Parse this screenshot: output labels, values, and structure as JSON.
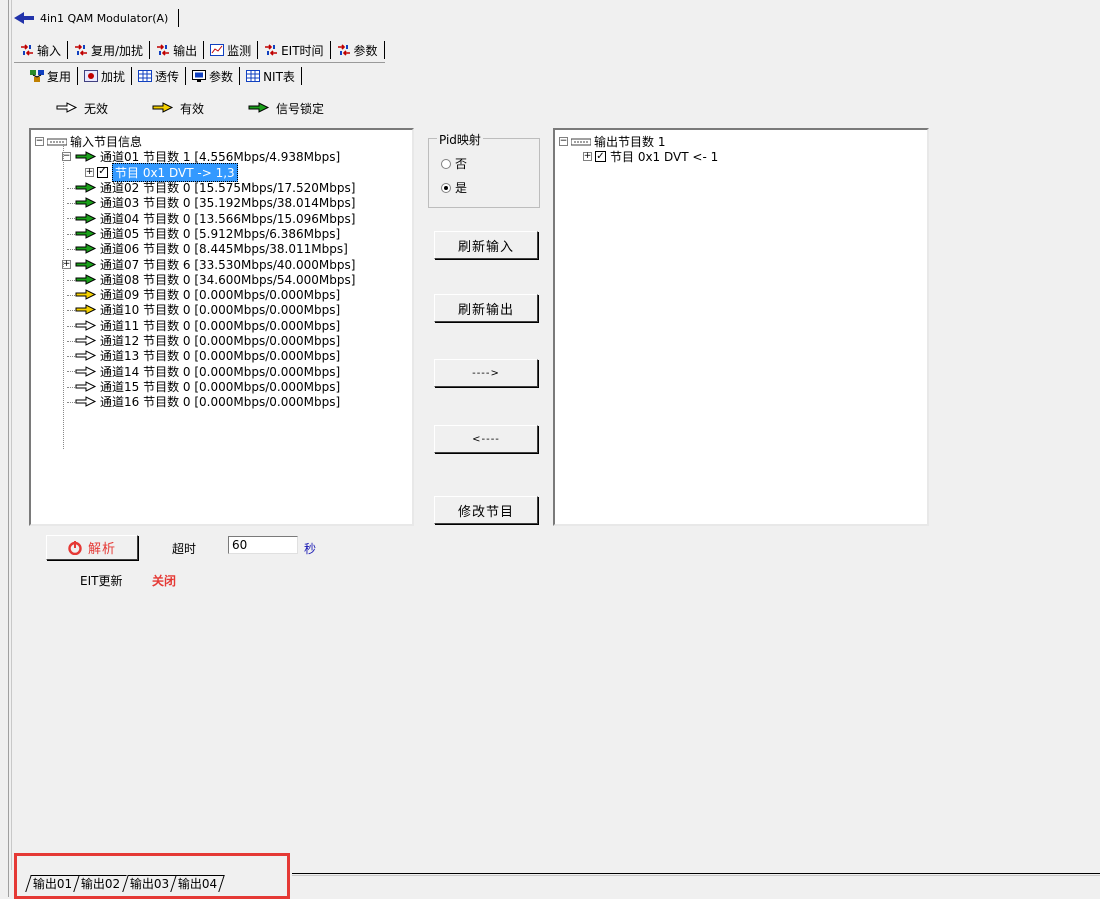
{
  "window": {
    "title": "4in1 QAM Modulator(A)"
  },
  "main_tabs": [
    "输入",
    "复用/加扰",
    "输出",
    "监测",
    "EIT时间",
    "参数"
  ],
  "sub_tabs": [
    "复用",
    "加扰",
    "透传",
    "参数",
    "NIT表"
  ],
  "legend": [
    {
      "label": "无效",
      "color": "#ffffff"
    },
    {
      "label": "有效",
      "color": "#f5d000"
    },
    {
      "label": "信号锁定",
      "color": "#1aa01a"
    }
  ],
  "input_tree": {
    "root": "输入节目信息",
    "channels": [
      {
        "text": "通道01 节目数 1 [4.556Mbps/4.938Mbps]",
        "status": "locked",
        "expanded": true,
        "children": [
          {
            "text": "节目 0x1 DVT -> 1,3",
            "checked": true,
            "selected": true
          }
        ]
      },
      {
        "text": "通道02 节目数 0 [15.575Mbps/17.520Mbps]",
        "status": "locked"
      },
      {
        "text": "通道03 节目数 0 [35.192Mbps/38.014Mbps]",
        "status": "locked"
      },
      {
        "text": "通道04 节目数 0 [13.566Mbps/15.096Mbps]",
        "status": "locked"
      },
      {
        "text": "通道05 节目数 0 [5.912Mbps/6.386Mbps]",
        "status": "locked"
      },
      {
        "text": "通道06 节目数 0 [8.445Mbps/38.011Mbps]",
        "status": "locked"
      },
      {
        "text": "通道07 节目数 6 [33.530Mbps/40.000Mbps]",
        "status": "locked",
        "collapsed": true
      },
      {
        "text": "通道08 节目数 0 [34.600Mbps/54.000Mbps]",
        "status": "locked"
      },
      {
        "text": "通道09 节目数 0 [0.000Mbps/0.000Mbps]",
        "status": "valid"
      },
      {
        "text": "通道10 节目数 0 [0.000Mbps/0.000Mbps]",
        "status": "valid"
      },
      {
        "text": "通道11 节目数 0 [0.000Mbps/0.000Mbps]",
        "status": "invalid"
      },
      {
        "text": "通道12 节目数 0 [0.000Mbps/0.000Mbps]",
        "status": "invalid"
      },
      {
        "text": "通道13 节目数 0 [0.000Mbps/0.000Mbps]",
        "status": "invalid"
      },
      {
        "text": "通道14 节目数 0 [0.000Mbps/0.000Mbps]",
        "status": "invalid"
      },
      {
        "text": "通道15 节目数 0 [0.000Mbps/0.000Mbps]",
        "status": "invalid"
      },
      {
        "text": "通道16 节目数 0 [0.000Mbps/0.000Mbps]",
        "status": "invalid"
      }
    ]
  },
  "pid_mapping": {
    "legend": "Pid映射",
    "options": [
      {
        "label": "否",
        "selected": false
      },
      {
        "label": "是",
        "selected": true
      }
    ]
  },
  "buttons": {
    "refresh_input": "刷新输入",
    "refresh_output": "刷新输出",
    "move_right": "---->",
    "move_left": "<----",
    "modify_program": "修改节目",
    "parse": "解析"
  },
  "output_tree": {
    "root": "输出节目数 1",
    "items": [
      {
        "text": "节目 0x1 DVT <- 1",
        "checked": true
      }
    ]
  },
  "timeout": {
    "label": "超时",
    "value": "60",
    "unit": "秒"
  },
  "eit": {
    "label": "EIT更新",
    "status": "关闭",
    "status_color": "#e53935"
  },
  "output_tabs": [
    "输出01",
    "输出02",
    "输出03",
    "输出04"
  ],
  "status_colors": {
    "locked": "#1aa01a",
    "valid": "#f5d000",
    "invalid": "#ffffff",
    "highlight": "#e53935"
  }
}
